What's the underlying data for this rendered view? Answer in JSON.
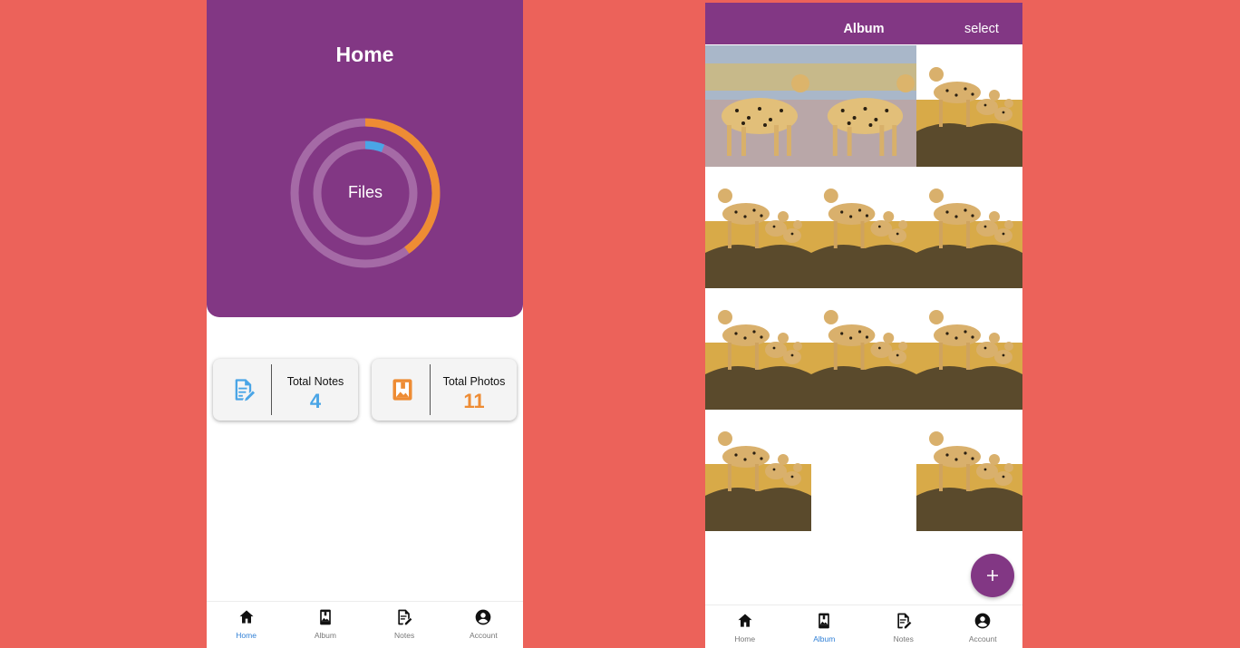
{
  "colors": {
    "background": "#ec625a",
    "primary": "#823784",
    "notes_accent": "#4aa5e6",
    "photos_accent": "#ee8c34",
    "active_nav": "#2f7fd6"
  },
  "home": {
    "title": "Home",
    "files_label": "Files",
    "stats": [
      {
        "label": "Total Notes",
        "value": "4",
        "icon": "note-edit-icon"
      },
      {
        "label": "Total Photos",
        "value": "11",
        "icon": "photo-icon"
      }
    ],
    "files_ring": {
      "photos_fraction": 0.4,
      "notes_fraction": 0.06
    }
  },
  "album": {
    "title": "Album",
    "select_label": "select",
    "fab_icon": "plus-icon",
    "photos": [
      "cheetah-single",
      "cheetah-single",
      "cheetah-family",
      "cheetah-family",
      "cheetah-family",
      "cheetah-family",
      "cheetah-family",
      "cheetah-family",
      "cheetah-family",
      "cheetah-family",
      "empty",
      "cheetah-family"
    ]
  },
  "nav": [
    {
      "label": "Home",
      "icon": "home-icon"
    },
    {
      "label": "Album",
      "icon": "album-icon"
    },
    {
      "label": "Notes",
      "icon": "notes-icon"
    },
    {
      "label": "Account",
      "icon": "account-icon"
    }
  ],
  "nav_active": {
    "home_screen": "Home",
    "album_screen": "Album"
  }
}
